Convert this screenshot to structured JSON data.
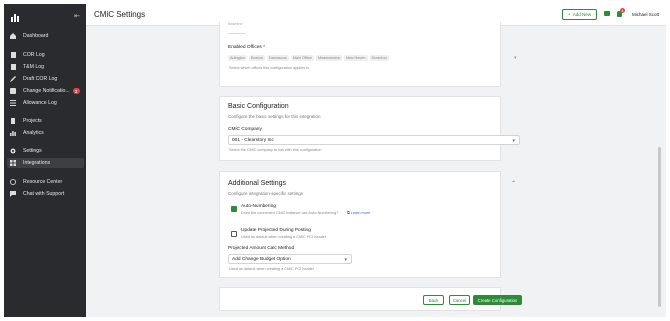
{
  "app": {
    "page_title": "CMiC Settings",
    "add_new_label": "Add New",
    "user_name": "Michael Scott",
    "notification_count": "4"
  },
  "sidebar": {
    "items": [
      {
        "label": "Dashboard",
        "icon": "home-icon"
      },
      {
        "label": "COR Log",
        "icon": "document-icon"
      },
      {
        "label": "T&M Log",
        "icon": "document-icon"
      },
      {
        "label": "Draft COR Log",
        "icon": "pencil-icon"
      },
      {
        "label": "Change Notificatio...",
        "icon": "change-icon",
        "badge": "2"
      },
      {
        "label": "Allowance Log",
        "icon": "list-icon"
      },
      {
        "label": "Projects",
        "icon": "building-icon"
      },
      {
        "label": "Analytics",
        "icon": "chart-icon"
      },
      {
        "label": "Settings",
        "icon": "gear-icon"
      },
      {
        "label": "Integrations",
        "icon": "grid-icon"
      },
      {
        "label": "Resource Center",
        "icon": "help-icon"
      },
      {
        "label": "Chat with Support",
        "icon": "chat-icon"
      }
    ]
  },
  "offices": {
    "top_label": "Baseline",
    "label": "Enabled Offices *",
    "chips": [
      "Arlington",
      "Boston",
      "Damascus",
      "Main Office",
      "Meadowview",
      "New Haven",
      "Scranton"
    ],
    "helper": "Select which offices this configuration applies to"
  },
  "basic": {
    "title": "Basic Configuration",
    "subtitle": "Configure the basic settings for this integration",
    "company_label": "CMiC Company",
    "company_value": "001 - Clearstory Inc",
    "company_helper": "Select the CMiC company to link with this configuration"
  },
  "additional": {
    "title": "Additional Settings",
    "subtitle": "Configure integration-specific settings",
    "auto_label": "Auto-Numbering",
    "auto_helper": "Does the connected CMiC instance use Auto-Numbering?",
    "learn_more": "Learn more",
    "projected_label": "Update Projected During Posting",
    "projected_helper": "Used as default when creating a CMiC PCI header",
    "calc_label": "Projected Amount Calc Method",
    "calc_value": "Add Change Budget Option",
    "calc_helper": "Used as default when creating a CMiC PCI header"
  },
  "footer": {
    "back": "Back",
    "cancel": "Cancel",
    "create": "Create Configuration"
  },
  "colors": {
    "brand_green": "#2f8a3a",
    "sidebar_bg": "#2a2b2e",
    "badge_red": "#e04848"
  }
}
